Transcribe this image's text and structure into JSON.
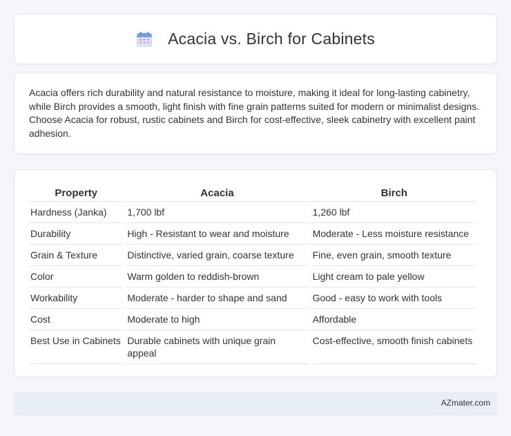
{
  "header": {
    "title": "Acacia vs. Birch for Cabinets",
    "icon": "calendar-icon"
  },
  "summary": {
    "text": "Acacia offers rich durability and natural resistance to moisture, making it ideal for long-lasting cabinetry, while Birch provides a smooth, light finish with fine grain patterns suited for modern or minimalist designs. Choose Acacia for robust, rustic cabinets and Birch for cost-effective, sleek cabinetry with excellent paint adhesion."
  },
  "table": {
    "headers": [
      "Property",
      "Acacia",
      "Birch"
    ],
    "rows": [
      [
        "Hardness (Janka)",
        "1,700 lbf",
        "1,260 lbf"
      ],
      [
        "Durability",
        "High - Resistant to wear and moisture",
        "Moderate - Less moisture resistance"
      ],
      [
        "Grain & Texture",
        "Distinctive, varied grain, coarse texture",
        "Fine, even grain, smooth texture"
      ],
      [
        "Color",
        "Warm golden to reddish-brown",
        "Light cream to pale yellow"
      ],
      [
        "Workability",
        "Moderate - harder to shape and sand",
        "Good - easy to work with tools"
      ],
      [
        "Cost",
        "Moderate to high",
        "Affordable"
      ],
      [
        "Best Use in Cabinets",
        "Durable cabinets with unique grain appeal",
        "Cost-effective, smooth finish cabinets"
      ]
    ]
  },
  "footer": {
    "brand": "AZmater.com"
  }
}
